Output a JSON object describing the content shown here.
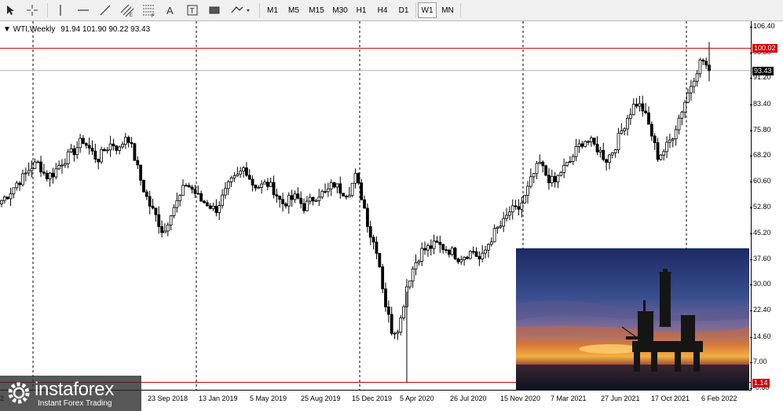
{
  "toolbar": {
    "tools": [
      {
        "name": "cursor-icon"
      },
      {
        "name": "crosshair-icon"
      },
      {
        "name": "vertical-line-icon"
      },
      {
        "name": "horizontal-line-icon"
      },
      {
        "name": "trendline-icon"
      },
      {
        "name": "equidistant-channel-icon"
      },
      {
        "name": "fibonacci-icon"
      },
      {
        "name": "text-icon"
      },
      {
        "name": "text-label-icon"
      },
      {
        "name": "rectangle-icon"
      },
      {
        "name": "shapes-dropdown-icon"
      }
    ],
    "timeframes": [
      "M1",
      "M5",
      "M15",
      "M30",
      "H1",
      "H4",
      "D1",
      "W1",
      "MN"
    ],
    "active_timeframe": "W1"
  },
  "chart": {
    "symbol_label": "WTI,Weekly",
    "ohlc_label": "91.94 101.90 90.22 93.43"
  },
  "chart_data": {
    "type": "candlestick",
    "symbol": "WTI",
    "period": "Weekly",
    "last_ohlc": {
      "open": 91.94,
      "high": 101.9,
      "low": 90.22,
      "close": 93.43
    },
    "y_ticks": [
      "106.40",
      "98.80",
      "91.20",
      "83.40",
      "75.80",
      "68.20",
      "60.60",
      "52.80",
      "45.20",
      "37.60",
      "30.00",
      "22.40",
      "14.60",
      "7.00",
      "-0.60"
    ],
    "x_ticks": [
      "23 Sep 2018",
      "13 Jan 2019",
      "5 May 2019",
      "25 Aug 2019",
      "15 Dec 2019",
      "5 Apr 2020",
      "26 Jul 2020",
      "15 Nov 2020",
      "7 Mar 2021",
      "27 Jun 2021",
      "17 Oct 2021",
      "6 Feb 2022"
    ],
    "x_tick_first_partial": "2",
    "ylim": [
      -0.6,
      106.4
    ],
    "price_lines": [
      {
        "label": "100.02",
        "color": "#d00000"
      },
      {
        "label": "93.43",
        "color": "#000000"
      },
      {
        "label": "1.14",
        "color": "#d00000"
      }
    ],
    "close_path": [
      [
        "2018-05",
        55
      ],
      [
        "2018-06",
        57
      ],
      [
        "2018-07",
        60
      ],
      [
        "2018-08",
        62
      ],
      [
        "2018-09",
        65
      ],
      [
        "2018-10",
        66
      ],
      [
        "2018-11",
        62
      ],
      [
        "2018-12",
        63
      ],
      [
        "2019-01",
        66
      ],
      [
        "2019-02",
        68
      ],
      [
        "2019-03",
        70
      ],
      [
        "2019-04",
        73
      ],
      [
        "2019-05",
        70
      ],
      [
        "2019-06",
        67
      ],
      [
        "2019-07",
        70
      ],
      [
        "2019-08",
        72
      ],
      [
        "2019-09",
        70
      ],
      [
        "2019-10",
        75
      ],
      [
        "2019-11",
        68
      ],
      [
        "2019-12",
        60
      ],
      [
        "2020-01",
        54
      ],
      [
        "2020-02",
        50
      ],
      [
        "2020-03",
        45
      ],
      [
        "2020-04",
        52
      ],
      [
        "2020-05",
        55
      ],
      [
        "2020-06",
        60
      ],
      [
        "2020-07",
        58
      ],
      [
        "2020-08",
        55
      ],
      [
        "2020-09",
        54
      ],
      [
        "2020-10",
        52
      ],
      [
        "2020-11",
        56
      ],
      [
        "2020-12",
        60
      ],
      [
        "2021-01",
        62
      ],
      [
        "2021-02",
        65
      ],
      [
        "2021-03",
        60
      ],
      [
        "2021-04",
        59
      ],
      [
        "2021-05",
        60
      ],
      [
        "2021-06",
        58
      ],
      [
        "2021-07",
        54
      ],
      [
        "2021-08",
        55
      ],
      [
        "2021-09",
        56
      ],
      [
        "2021-10",
        53
      ],
      [
        "2021-11",
        55
      ],
      [
        "2021-12",
        57
      ],
      [
        "2022-01",
        57
      ],
      [
        "2022-02",
        60
      ],
      [
        "2022-03",
        58
      ],
      [
        "2022-04",
        57
      ],
      [
        "2022-05",
        62
      ],
      [
        "2022-06",
        55
      ],
      [
        "2022-07",
        45
      ],
      [
        "2022-08",
        40
      ],
      [
        "2022-09",
        25
      ],
      [
        "2022-10",
        16
      ],
      [
        "2022-11",
        18
      ],
      [
        "2022-12",
        30
      ],
      [
        "2023-01",
        36
      ],
      [
        "2023-02",
        40
      ],
      [
        "2023-03",
        41
      ],
      [
        "2023-04",
        42
      ],
      [
        "2023-05",
        41
      ],
      [
        "2023-06",
        40
      ],
      [
        "2023-07",
        38
      ],
      [
        "2023-08",
        39
      ],
      [
        "2023-09",
        40
      ],
      [
        "2023-10",
        37
      ],
      [
        "2023-11",
        42
      ],
      [
        "2023-12",
        46
      ],
      [
        "2024-01",
        48
      ],
      [
        "2024-02",
        52
      ],
      [
        "2024-03",
        52
      ],
      [
        "2024-04",
        56
      ],
      [
        "2024-05",
        62
      ],
      [
        "2024-06",
        66
      ],
      [
        "2024-07",
        62
      ],
      [
        "2024-08",
        60
      ],
      [
        "2024-09",
        64
      ],
      [
        "2024-10",
        66
      ],
      [
        "2024-11",
        70
      ],
      [
        "2024-12",
        73
      ],
      [
        "2025-01",
        72
      ],
      [
        "2025-02",
        70
      ],
      [
        "2025-03",
        67
      ],
      [
        "2025-04",
        70
      ],
      [
        "2025-05",
        75
      ],
      [
        "2025-06",
        80
      ],
      [
        "2025-07",
        84
      ],
      [
        "2025-08",
        82
      ],
      [
        "2025-09",
        76
      ],
      [
        "2025-10",
        68
      ],
      [
        "2025-11",
        70
      ],
      [
        "2025-12",
        74
      ],
      [
        "2026-01",
        80
      ],
      [
        "2026-02",
        86
      ],
      [
        "2026-03",
        92
      ],
      [
        "2026-04",
        97
      ],
      [
        "2026-05",
        93.4
      ]
    ]
  },
  "watermark": {
    "brand": "instaforex",
    "tagline": "Instant Forex Trading"
  },
  "colors": {
    "bull": "#ffffff",
    "bear": "#000000",
    "price_line_red": "#d00000",
    "grid_vertical": "#000000"
  }
}
